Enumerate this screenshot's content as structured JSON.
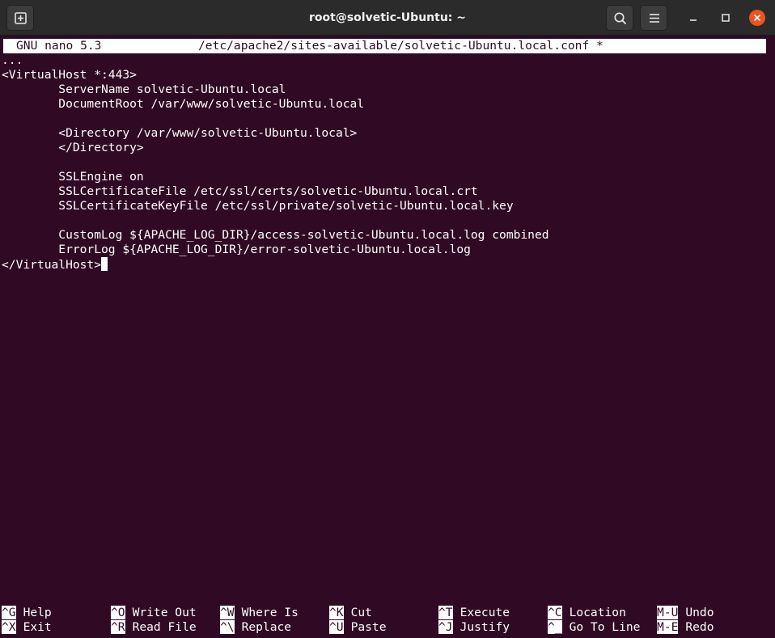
{
  "window": {
    "title": "root@solvetic-Ubuntu: ~"
  },
  "nano": {
    "version": "GNU nano 5.3",
    "filename": "/etc/apache2/sites-available/solvetic-Ubuntu.local.conf *"
  },
  "editor": {
    "lines": [
      "...",
      "<VirtualHost *:443>",
      "        ServerName solvetic-Ubuntu.local",
      "        DocumentRoot /var/www/solvetic-Ubuntu.local",
      "",
      "        <Directory /var/www/solvetic-Ubuntu.local>",
      "        </Directory>",
      "",
      "        SSLEngine on",
      "        SSLCertificateFile /etc/ssl/certs/solvetic-Ubuntu.local.crt",
      "        SSLCertificateKeyFile /etc/ssl/private/solvetic-Ubuntu.local.key",
      "",
      "        CustomLog ${APACHE_LOG_DIR}/access-solvetic-Ubuntu.local.log combined",
      "        ErrorLog ${APACHE_LOG_DIR}/error-solvetic-Ubuntu.local.log",
      "</VirtualHost>"
    ]
  },
  "shortcuts": [
    [
      {
        "key": "^G",
        "label": "Help"
      },
      {
        "key": "^O",
        "label": "Write Out"
      },
      {
        "key": "^W",
        "label": "Where Is"
      },
      {
        "key": "^K",
        "label": "Cut"
      },
      {
        "key": "^T",
        "label": "Execute"
      },
      {
        "key": "^C",
        "label": "Location"
      },
      {
        "key": "M-U",
        "label": "Undo"
      }
    ],
    [
      {
        "key": "^X",
        "label": "Exit"
      },
      {
        "key": "^R",
        "label": "Read File"
      },
      {
        "key": "^\\",
        "label": "Replace"
      },
      {
        "key": "^U",
        "label": "Paste"
      },
      {
        "key": "^J",
        "label": "Justify"
      },
      {
        "key": "^_",
        "label": "Go To Line"
      },
      {
        "key": "M-E",
        "label": "Redo"
      }
    ]
  ],
  "colors": {
    "terminal_bg": "#300a24",
    "foreground": "#ffffff",
    "titlebar_bg": "#2b2b2b",
    "close_button": "#e95420"
  },
  "icons": {
    "new_tab": "new-tab-icon",
    "search": "search-icon",
    "menu": "hamburger-menu-icon",
    "minimize": "minimize-icon",
    "maximize": "maximize-icon",
    "close": "close-icon"
  }
}
